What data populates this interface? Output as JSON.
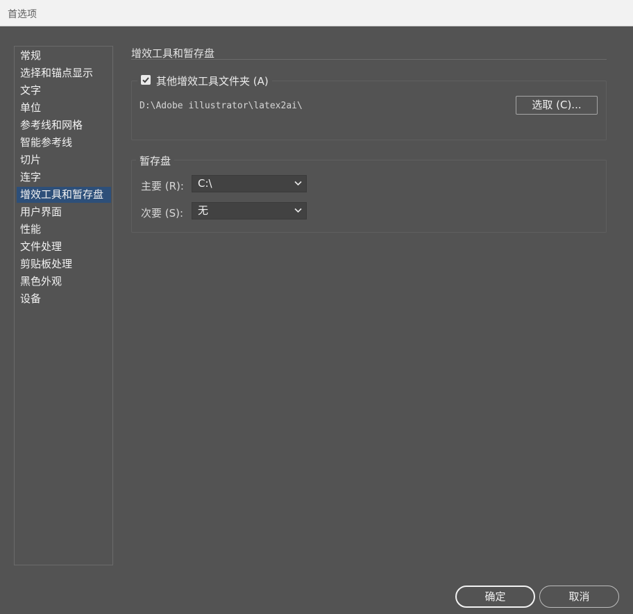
{
  "window": {
    "title": "首选项"
  },
  "sidebar": {
    "items": [
      {
        "label": "常规"
      },
      {
        "label": "选择和锚点显示"
      },
      {
        "label": "文字"
      },
      {
        "label": "单位"
      },
      {
        "label": "参考线和网格"
      },
      {
        "label": "智能参考线"
      },
      {
        "label": "切片"
      },
      {
        "label": "连字"
      },
      {
        "label": "增效工具和暂存盘",
        "selected": true
      },
      {
        "label": "用户界面"
      },
      {
        "label": "性能"
      },
      {
        "label": "文件处理"
      },
      {
        "label": "剪贴板处理"
      },
      {
        "label": "黑色外观"
      },
      {
        "label": "设备"
      }
    ],
    "selected_color": "#2d4f79"
  },
  "panel": {
    "title": "增效工具和暂存盘",
    "plugins": {
      "checkbox_label": "其他增效工具文件夹 (A)",
      "checked": true,
      "path": "D:\\Adobe illustrator\\latex2ai\\",
      "choose_button": "选取 (C)..."
    },
    "scratch": {
      "legend": "暂存盘",
      "primary_label": "主要 (R):",
      "primary_value": "C:\\",
      "secondary_label": "次要 (S):",
      "secondary_value": "无"
    }
  },
  "footer": {
    "ok": "确定",
    "cancel": "取消"
  },
  "icons": {
    "checkbox": "checkmark-icon",
    "dropdown": "chevron-down-icon"
  }
}
